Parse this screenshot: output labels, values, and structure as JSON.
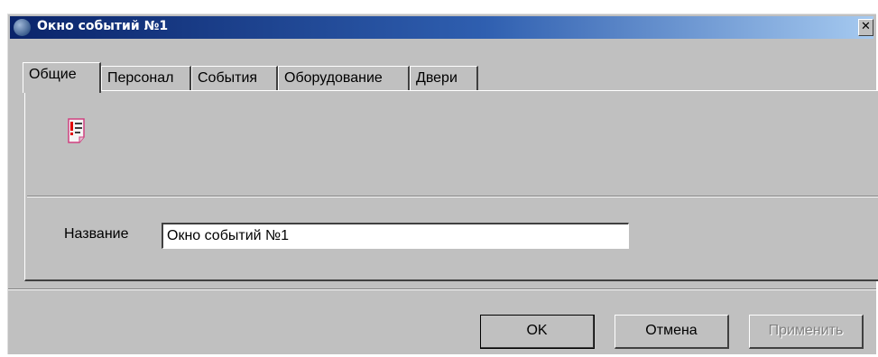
{
  "window": {
    "title": "Окно событий №1",
    "close_glyph": "✕",
    "icon": "app-globe-icon"
  },
  "tabs": [
    {
      "label": "Общие",
      "active": true
    },
    {
      "label": "Персонал",
      "active": false
    },
    {
      "label": "События",
      "active": false
    },
    {
      "label": "Оборудование",
      "active": false
    },
    {
      "label": "Двери",
      "active": false
    }
  ],
  "general": {
    "icon": "event-list-icon",
    "name_label": "Название",
    "name_value": "Окно событий №1"
  },
  "buttons": {
    "ok": "OK",
    "cancel": "Отмена",
    "apply": "Применить"
  },
  "colors": {
    "face": "#c0c0c0",
    "title_start": "#0a246a",
    "title_end": "#a6caf0"
  }
}
